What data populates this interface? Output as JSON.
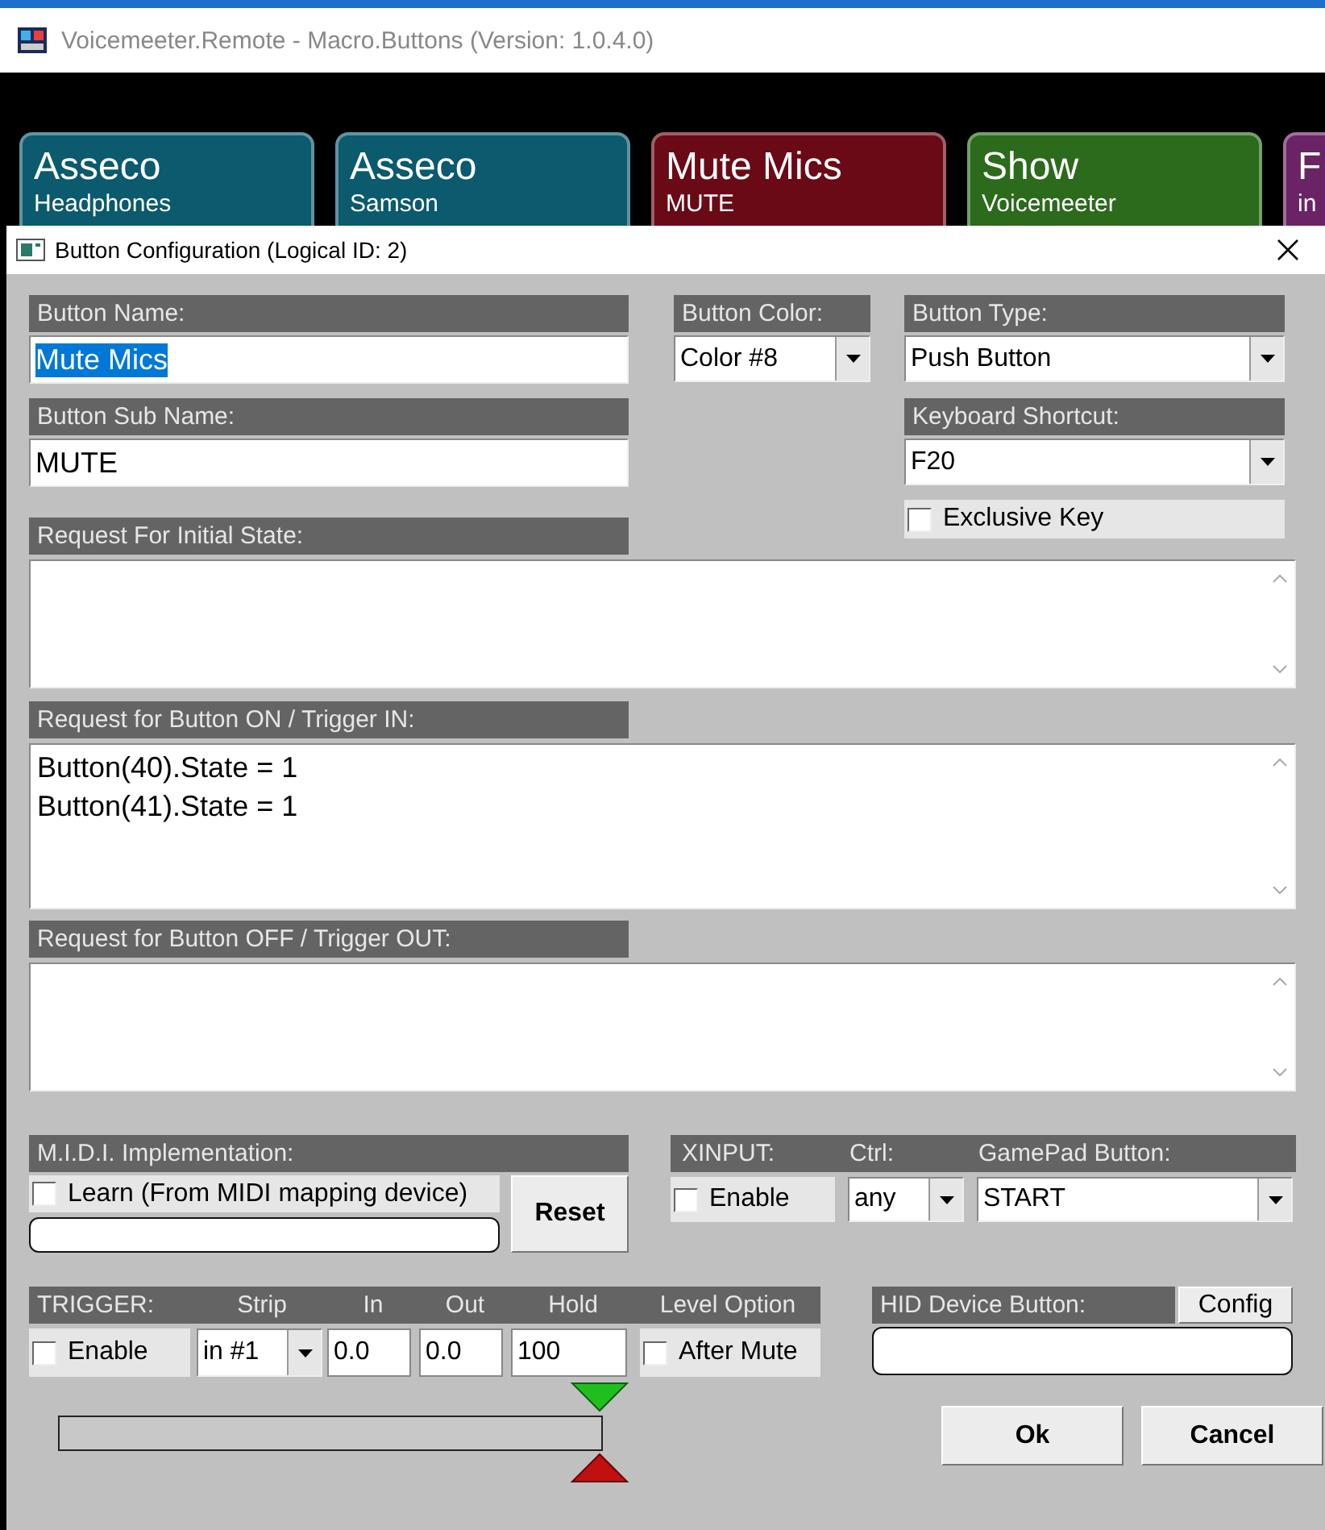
{
  "main_window": {
    "title": "Voicemeeter.Remote - Macro.Buttons (Version: 1.0.4.0)"
  },
  "macro_buttons": [
    {
      "name": "Asseco",
      "sub_name": "Headphones",
      "color": "#0b5a6e"
    },
    {
      "name": "Asseco",
      "sub_name": "Samson",
      "color": "#0b5a6e"
    },
    {
      "name": "Mute Mics",
      "sub_name": "MUTE",
      "color": "#6a0a16"
    },
    {
      "name": "Show",
      "sub_name": "Voicemeeter",
      "color": "#2c6a1c"
    },
    {
      "name": "F",
      "sub_name": "in",
      "color": "#6a2466"
    }
  ],
  "dialog": {
    "title": "Button Configuration (Logical ID: 2)",
    "button_name": {
      "label": "Button Name:",
      "value": "Mute Mics",
      "text_selected": true
    },
    "button_color": {
      "label": "Button Color:",
      "value": "Color #8"
    },
    "button_type": {
      "label": "Button Type:",
      "value": "Push Button"
    },
    "button_sub_name": {
      "label": "Button Sub Name:",
      "value": "MUTE",
      "text_selected": false
    },
    "keyboard_shortcut": {
      "label": "Keyboard Shortcut:",
      "value": "F20"
    },
    "exclusive_key": {
      "label": "Exclusive Key",
      "checked": false
    },
    "requests": [
      {
        "label": "Request For Initial State:"
      },
      {
        "label": "Request for Button ON / Trigger IN:",
        "value": "Button(40).State = 1\nButton(41).State = 1"
      },
      {
        "label": "Request for Button OFF / Trigger OUT:"
      }
    ],
    "midi": {
      "label": "M.I.D.I. Implementation:",
      "learn": {
        "label": "Learn (From MIDI mapping device)",
        "checked": false
      },
      "reset_button": "Reset"
    },
    "xinput": {
      "headers": [
        "XINPUT:",
        "Ctrl:",
        "GamePad Button:"
      ],
      "enable": {
        "label": "Enable",
        "checked": false
      },
      "ctrl": "any",
      "gamepad_button": "START"
    },
    "trigger": {
      "headers": [
        "TRIGGER:",
        "Strip",
        "In",
        "Out",
        "Hold",
        "Level Option"
      ],
      "enable": {
        "label": "Enable",
        "checked": false
      },
      "strip": "in #1",
      "in": "0.0",
      "out": "0.0",
      "hold": "100",
      "after_mute": {
        "label": "After Mute",
        "checked": false
      }
    },
    "hid": {
      "label": "HID Device Button:",
      "config_button": "Config"
    },
    "buttons": [
      "Ok",
      "Cancel"
    ]
  }
}
